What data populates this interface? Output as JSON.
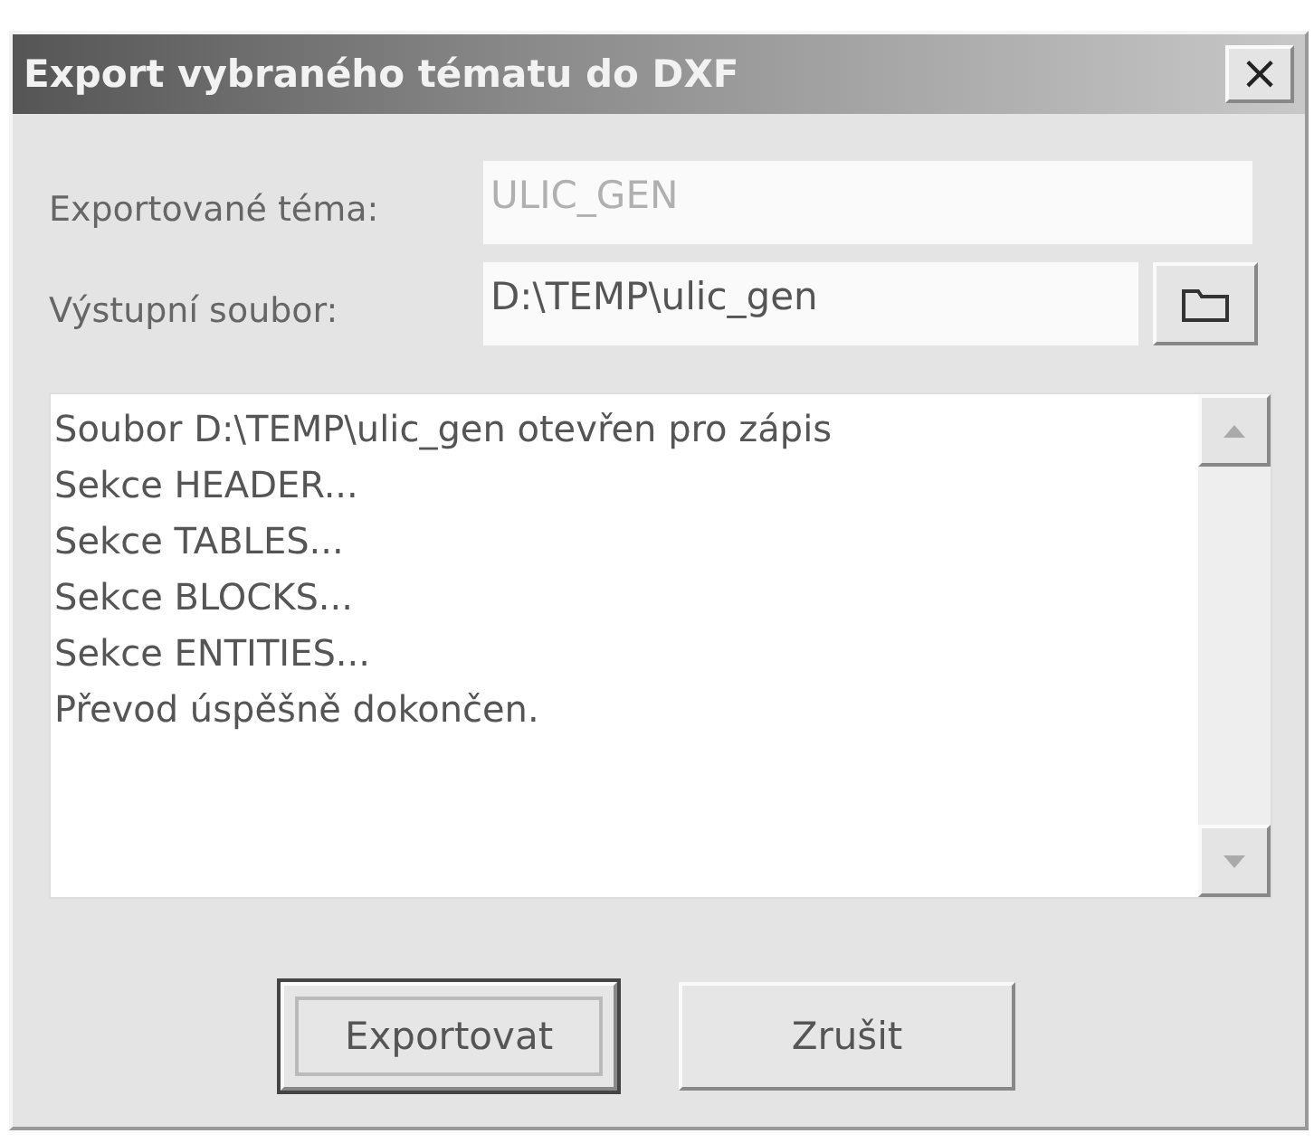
{
  "window": {
    "title": "Export vybraného tématu do DXF",
    "close": "×"
  },
  "fields": [
    {
      "label": "Exportované téma:",
      "value": "ULIC_GEN",
      "disabled": true,
      "browse": false
    },
    {
      "label": "Výstupní soubor:",
      "value": "D:\\TEMP\\ulic_gen",
      "disabled": false,
      "browse": true
    }
  ],
  "log": [
    "Soubor D:\\TEMP\\ulic_gen otevřen pro zápis",
    "Sekce HEADER...",
    "Sekce TABLES...",
    "Sekce BLOCKS...",
    "Sekce ENTITIES...",
    "Převod úspěšně dokončen."
  ],
  "buttons": [
    {
      "label": "Exportovat",
      "default": true
    },
    {
      "label": "Zrušit",
      "default": false
    }
  ]
}
